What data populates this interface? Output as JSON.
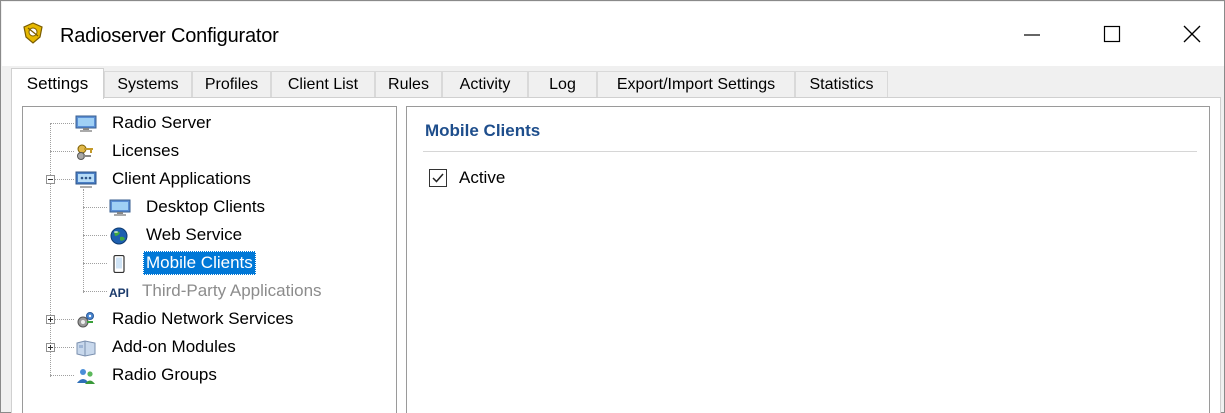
{
  "window": {
    "title": "Radioserver Configurator",
    "app_icon": "radioserver-shield-icon",
    "controls": {
      "minimize": "minimize-icon",
      "maximize": "maximize-icon",
      "close": "close-icon"
    }
  },
  "tabs": [
    {
      "label": "Settings",
      "active": true
    },
    {
      "label": "Systems"
    },
    {
      "label": "Profiles"
    },
    {
      "label": "Client List"
    },
    {
      "label": "Rules"
    },
    {
      "label": "Activity"
    },
    {
      "label": "Log"
    },
    {
      "label": "Export/Import Settings"
    },
    {
      "label": "Statistics"
    }
  ],
  "tree": {
    "items": [
      {
        "label": "Radio Server",
        "icon": "monitor-icon"
      },
      {
        "label": "Licenses",
        "icon": "keys-icon"
      },
      {
        "label": "Client Applications",
        "icon": "client-apps-icon",
        "expanded": true
      },
      {
        "label": "Desktop Clients",
        "icon": "monitor-icon"
      },
      {
        "label": "Web Service",
        "icon": "globe-icon"
      },
      {
        "label": "Mobile Clients",
        "icon": "mobile-phone-icon",
        "selected": true
      },
      {
        "label": "Third-Party Applications",
        "icon": "api-icon",
        "icon_text": "API",
        "disabled": true
      },
      {
        "label": "Radio Network Services",
        "icon": "gears-icon",
        "expanded": false
      },
      {
        "label": "Add-on Modules",
        "icon": "modules-icon",
        "expanded": false
      },
      {
        "label": "Radio Groups",
        "icon": "users-group-icon"
      }
    ]
  },
  "detail": {
    "title": "Mobile Clients",
    "active_checkbox": {
      "label": "Active",
      "checked": true
    }
  },
  "colors": {
    "selection": "#0078d7",
    "section_title": "#1e4e8c",
    "disabled_text": "#8c8c8c"
  }
}
